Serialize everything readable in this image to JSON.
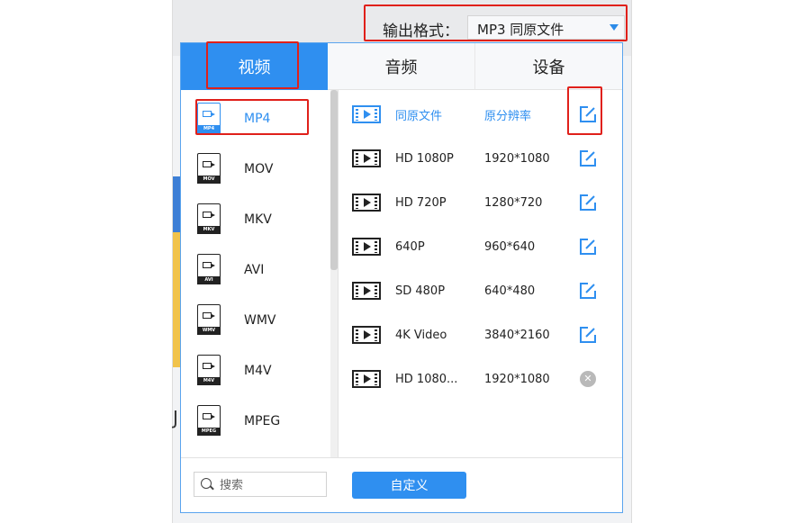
{
  "output_format": {
    "label": "输出格式：",
    "value": "MP3 同原文件"
  },
  "tabs": [
    {
      "label": "视频",
      "active": true
    },
    {
      "label": "音频",
      "active": false
    },
    {
      "label": "设备",
      "active": false
    }
  ],
  "formats": [
    {
      "name": "MP4",
      "badge": "MP4",
      "selected": true
    },
    {
      "name": "MOV",
      "badge": "MOV",
      "selected": false
    },
    {
      "name": "MKV",
      "badge": "MKV",
      "selected": false
    },
    {
      "name": "AVI",
      "badge": "AVI",
      "selected": false
    },
    {
      "name": "WMV",
      "badge": "WMV",
      "selected": false
    },
    {
      "name": "M4V",
      "badge": "M4V",
      "selected": false
    },
    {
      "name": "MPEG",
      "badge": "MPEG",
      "selected": false
    }
  ],
  "presets": [
    {
      "name": "同原文件",
      "resolution": "原分辨率",
      "action": "edit"
    },
    {
      "name": "HD 1080P",
      "resolution": "1920*1080",
      "action": "edit"
    },
    {
      "name": "HD 720P",
      "resolution": "1280*720",
      "action": "edit"
    },
    {
      "name": "640P",
      "resolution": "960*640",
      "action": "edit"
    },
    {
      "name": "SD 480P",
      "resolution": "640*480",
      "action": "edit"
    },
    {
      "name": "4K Video",
      "resolution": "3840*2160",
      "action": "edit"
    },
    {
      "name": "HD 1080...",
      "resolution": "1920*1080",
      "action": "delete"
    }
  ],
  "search": {
    "placeholder": "搜索"
  },
  "custom_button": "自定义",
  "background": {
    "bracket_text": "J"
  },
  "colors": {
    "accent": "#2f8ff0",
    "highlight": "#e0201a",
    "text": "#222222"
  },
  "icons": {
    "edit": "edit-icon",
    "delete": "close-icon",
    "search": "search-icon",
    "dropdown": "caret-down-icon",
    "preset": "film-icon",
    "format": "video-file-icon"
  }
}
